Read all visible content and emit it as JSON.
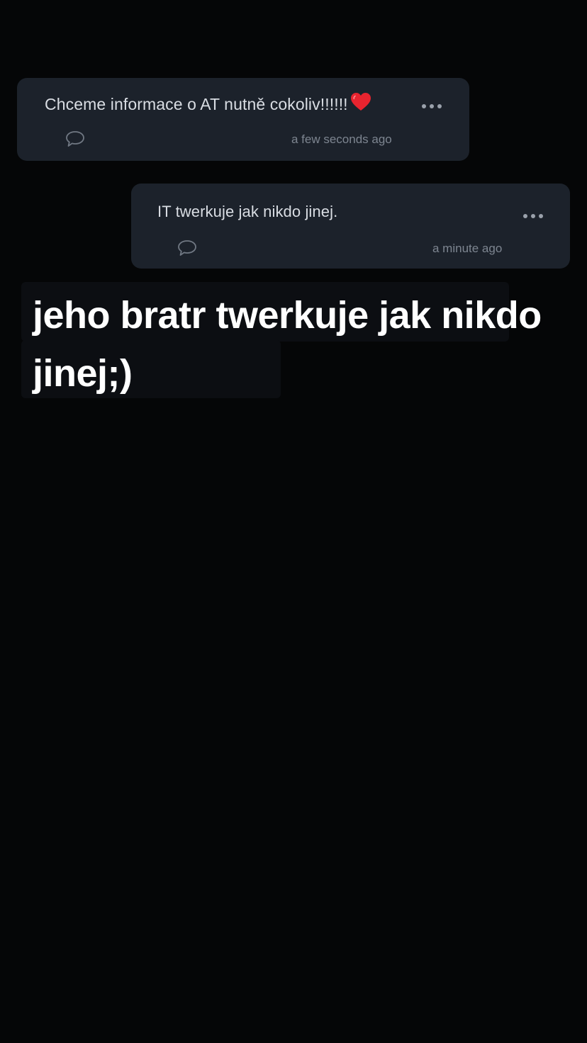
{
  "comments": [
    {
      "text": "Chceme informace o AT nutně cokoliv!!!!!!",
      "emoji": "red-heart",
      "timestamp": "a few seconds ago",
      "icons": {
        "more": "more-dots-icon",
        "reply": "comment-bubble-icon"
      }
    },
    {
      "text": "IT twerkuje jak nikdo jinej.",
      "timestamp": "a minute ago",
      "icons": {
        "more": "more-dots-icon",
        "reply": "comment-bubble-icon"
      }
    }
  ],
  "caption": "jeho bratr twerkuje jak nikdo jinej;)",
  "colors": {
    "background": "#050607",
    "card": "#1c222b",
    "heart": "#e8242f"
  }
}
